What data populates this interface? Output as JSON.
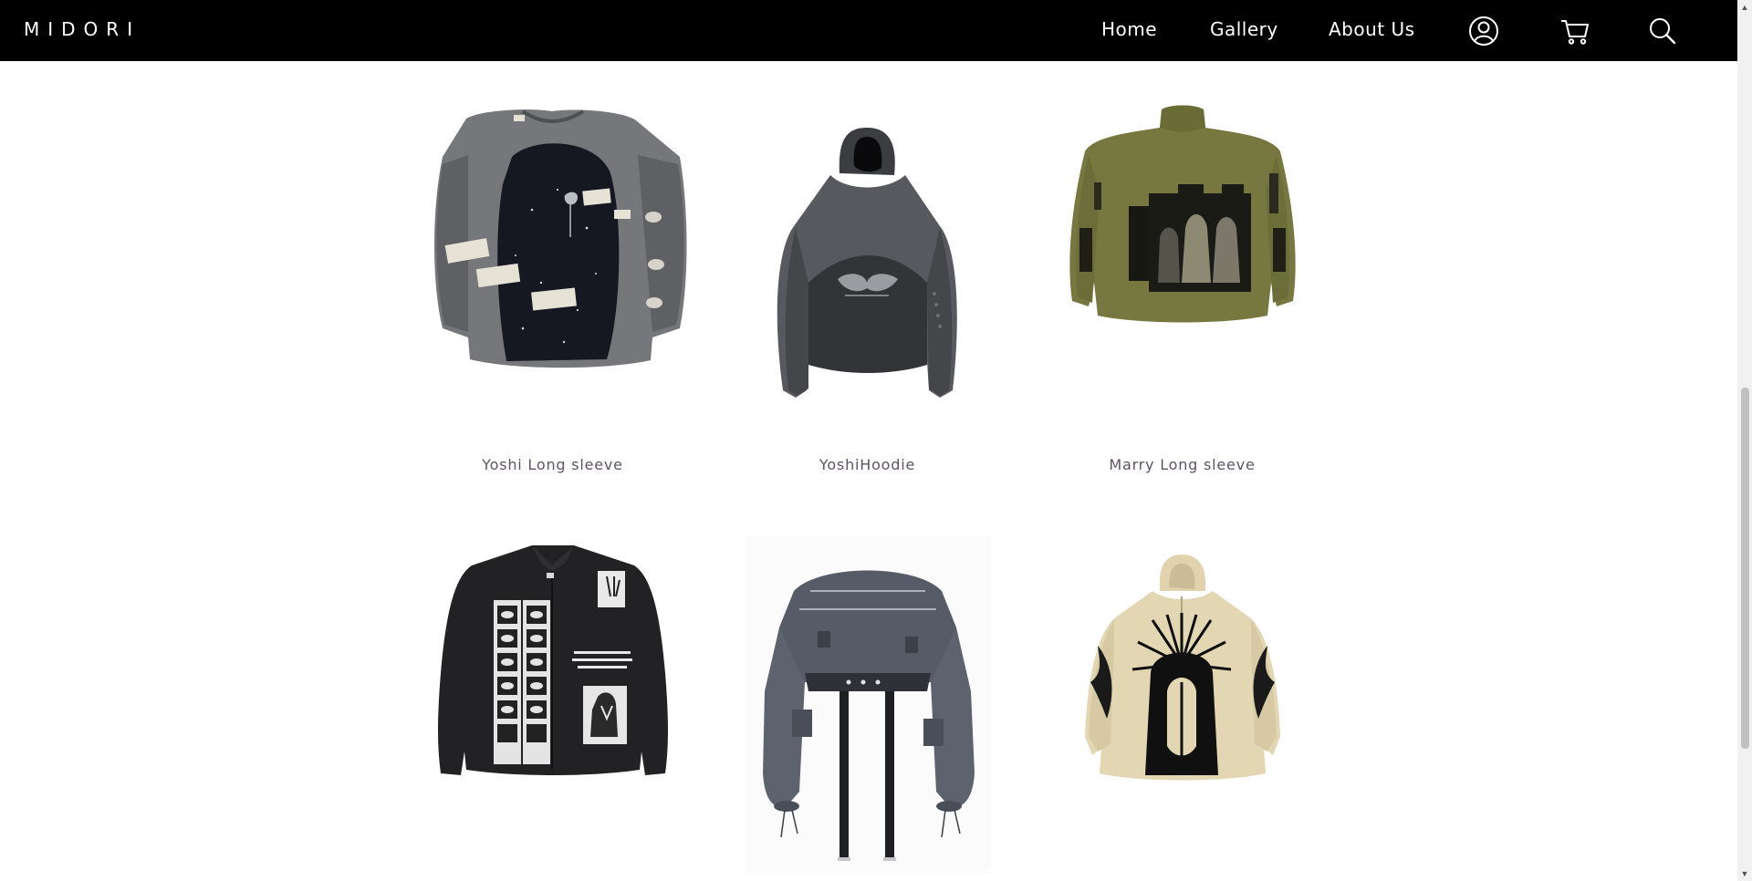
{
  "brand": {
    "logo": "MIDORI"
  },
  "nav": {
    "links": [
      {
        "label": "Home"
      },
      {
        "label": "Gallery"
      },
      {
        "label": "About Us"
      }
    ],
    "icons": [
      "account-icon",
      "cart-icon",
      "search-icon"
    ]
  },
  "products": [
    {
      "name": "Yoshi Long sleeve",
      "image": "grey-patched-longsleeve"
    },
    {
      "name": "YoshiHoodie",
      "image": "grey-hooded-cropped-hoodie"
    },
    {
      "name": "Marry Long sleeve",
      "image": "olive-graphic-longsleeve"
    },
    {
      "name": "",
      "image": "black-graphic-jacket"
    },
    {
      "name": "",
      "image": "grey-bondage-bolero"
    },
    {
      "name": "",
      "image": "beige-graphic-zip-hoodie"
    }
  ],
  "colors": {
    "nav_background": "#000000",
    "product_label": "#5d5366"
  }
}
